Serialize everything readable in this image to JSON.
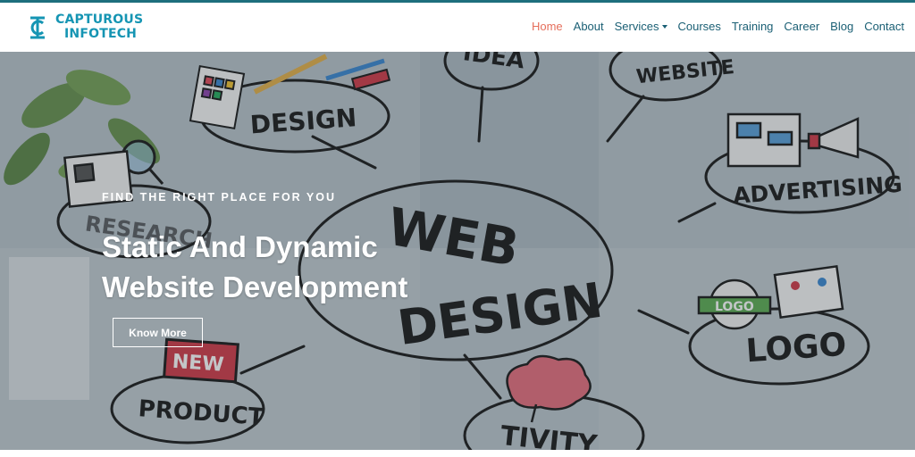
{
  "brand": {
    "line1": "CAPTUROUS",
    "line2": "INFOTECH",
    "color": "#1595b3"
  },
  "nav": {
    "items": [
      {
        "label": "Home",
        "active": true
      },
      {
        "label": "About"
      },
      {
        "label": "Services",
        "dropdown": true
      },
      {
        "label": "Courses"
      },
      {
        "label": "Training"
      },
      {
        "label": "Career"
      },
      {
        "label": "Blog"
      },
      {
        "label": "Contact"
      }
    ],
    "active_color": "#e56e5b",
    "link_color": "#1a5f74"
  },
  "hero": {
    "kicker": "FIND THE RIGHT PLACE FOR YOU",
    "headline_line1": "Static And Dynamic",
    "headline_line2": "Website Development",
    "cta_label": "Know More",
    "illustration_words": [
      "IDEA",
      "WEBSITE",
      "DESIGN",
      "RESEARCH",
      "ADVERTISING",
      "WEB",
      "DESIGN",
      "LOGO",
      "LOGO",
      "NEW",
      "PRODUCT",
      "TIVITY"
    ]
  }
}
